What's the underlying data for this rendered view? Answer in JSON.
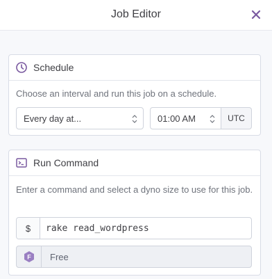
{
  "header": {
    "title": "Job Editor",
    "close_icon": "close-icon"
  },
  "schedule": {
    "title": "Schedule",
    "icon": "clock-icon",
    "description": "Choose an interval and run this job on a schedule.",
    "interval_value": "Every day at...",
    "time_value": "01:00 AM",
    "timezone": "UTC"
  },
  "run_command": {
    "title": "Run Command",
    "icon": "terminal-icon",
    "description": "Enter a command and select a dyno size to use for this job.",
    "prefix": "$",
    "command_value": "rake read_wordpress",
    "dyno_badge": "F",
    "dyno_size": "Free"
  },
  "colors": {
    "accent": "#79589f",
    "badge": "#9a7fc2"
  }
}
